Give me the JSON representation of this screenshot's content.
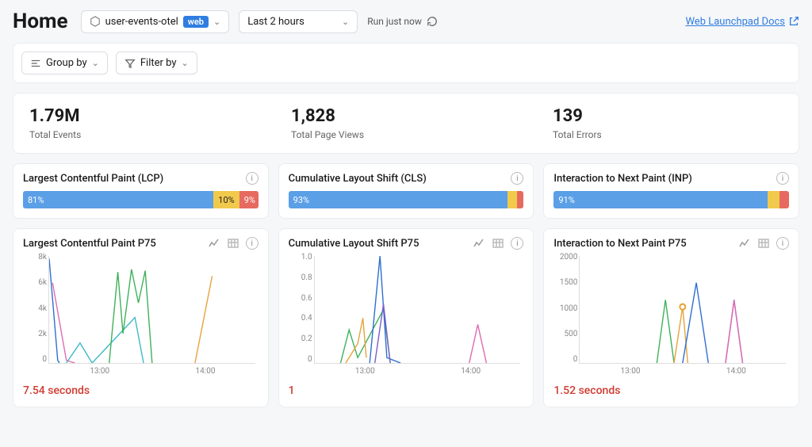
{
  "header": {
    "title": "Home",
    "dataset_name": "user-events-otel",
    "dataset_badge": "web",
    "time_range": "Last 2 hours",
    "run_status": "Run just now",
    "docs_link": "Web Launchpad Docs"
  },
  "filters": {
    "group_by_label": "Group by",
    "filter_by_label": "Filter by"
  },
  "stats": [
    {
      "value": "1.79M",
      "label": "Total Events"
    },
    {
      "value": "1,828",
      "label": "Total Page Views"
    },
    {
      "value": "139",
      "label": "Total Errors"
    }
  ],
  "vitals": [
    {
      "title": "Largest Contentful Paint (LCP)",
      "segments": [
        {
          "color": "blue",
          "pct": 81,
          "label": "81%"
        },
        {
          "color": "yellow",
          "pct": 10,
          "label": "10%"
        },
        {
          "color": "red",
          "pct": 9,
          "label": "9%"
        }
      ]
    },
    {
      "title": "Cumulative Layout Shift (CLS)",
      "segments": [
        {
          "color": "blue",
          "pct": 93,
          "label": "93%"
        },
        {
          "color": "yellow",
          "pct": 3,
          "label": ""
        },
        {
          "color": "red",
          "pct": 4,
          "label": ""
        }
      ]
    },
    {
      "title": "Interaction to Next Paint (INP)",
      "segments": [
        {
          "color": "blue",
          "pct": 91,
          "label": "91%"
        },
        {
          "color": "yellow",
          "pct": 5,
          "label": ""
        },
        {
          "color": "red",
          "pct": 4,
          "label": ""
        }
      ]
    }
  ],
  "p75": [
    {
      "title": "Largest Contentful Paint P75",
      "value": "7.54 seconds",
      "yticks": [
        "8k",
        "6k",
        "4k",
        "2k",
        "0"
      ],
      "xticks": [
        "13:00",
        "14:00"
      ]
    },
    {
      "title": "Cumulative Layout Shift P75",
      "value": "1",
      "yticks": [
        "1.0",
        "0.8",
        "0.6",
        "0.4",
        "0.2",
        "0"
      ],
      "xticks": [
        "13:00",
        "14:00"
      ]
    },
    {
      "title": "Interaction to Next Paint P75",
      "value": "1.52 seconds",
      "yticks": [
        "2000",
        "1500",
        "1000",
        "500",
        "0"
      ],
      "xticks": [
        "13:00",
        "14:00"
      ]
    }
  ],
  "chart_data": [
    {
      "type": "line",
      "title": "Largest Contentful Paint P75",
      "ylabel": "",
      "xlabel": "",
      "ylim": [
        0,
        8000
      ],
      "x_range": [
        "12:30",
        "14:30"
      ],
      "series": [
        {
          "name": "blue",
          "color": "#2f6fd1",
          "points": [
            [
              "12:30",
              7800
            ],
            [
              "12:35",
              200
            ],
            [
              "12:36",
              0
            ]
          ]
        },
        {
          "name": "pink",
          "color": "#e06bb1",
          "points": [
            [
              "12:32",
              6000
            ],
            [
              "12:40",
              200
            ],
            [
              "12:45",
              0
            ]
          ]
        },
        {
          "name": "cyan",
          "color": "#3fb9c9",
          "points": [
            [
              "12:40",
              0
            ],
            [
              "12:48",
              1500
            ],
            [
              "12:55",
              0
            ],
            [
              "13:20",
              3400
            ],
            [
              "13:25",
              0
            ]
          ]
        },
        {
          "name": "green",
          "color": "#3fb15a",
          "points": [
            [
              "13:05",
              0
            ],
            [
              "13:10",
              6800
            ],
            [
              "13:13",
              2200
            ],
            [
              "13:18",
              7000
            ],
            [
              "13:22",
              4500
            ],
            [
              "13:26",
              6900
            ],
            [
              "13:30",
              0
            ]
          ]
        },
        {
          "name": "orange",
          "color": "#e8a33b",
          "points": [
            [
              "13:55",
              0
            ],
            [
              "14:05",
              6500
            ]
          ]
        }
      ]
    },
    {
      "type": "line",
      "title": "Cumulative Layout Shift P75",
      "ylabel": "",
      "xlabel": "",
      "ylim": [
        0,
        1.0
      ],
      "x_range": [
        "12:30",
        "14:30"
      ],
      "series": [
        {
          "name": "green",
          "color": "#3fb15a",
          "points": [
            [
              "12:45",
              0
            ],
            [
              "12:50",
              0.31
            ],
            [
              "12:55",
              0.05
            ],
            [
              "13:10",
              0.5
            ],
            [
              "13:14",
              0
            ]
          ]
        },
        {
          "name": "orange",
          "color": "#e8a33b",
          "points": [
            [
              "12:48",
              0
            ],
            [
              "12:55",
              0.18
            ],
            [
              "12:58",
              0.42
            ],
            [
              "13:00",
              0.05
            ]
          ]
        },
        {
          "name": "blue",
          "color": "#2f6fd1",
          "points": [
            [
              "13:02",
              0
            ],
            [
              "13:08",
              1.0
            ],
            [
              "13:12",
              0.05
            ],
            [
              "13:20",
              0
            ]
          ]
        },
        {
          "name": "purple",
          "color": "#7a5fc9",
          "points": [
            [
              "13:05",
              0
            ],
            [
              "13:10",
              0.55
            ],
            [
              "13:14",
              0
            ]
          ]
        },
        {
          "name": "pink",
          "color": "#e06bb1",
          "points": [
            [
              "14:00",
              0
            ],
            [
              "14:05",
              0.36
            ],
            [
              "14:10",
              0
            ]
          ]
        }
      ]
    },
    {
      "type": "line",
      "title": "Interaction to Next Paint P75",
      "ylabel": "",
      "xlabel": "",
      "ylim": [
        0,
        2000
      ],
      "x_range": [
        "12:30",
        "14:30"
      ],
      "series": [
        {
          "name": "green",
          "color": "#3fb15a",
          "points": [
            [
              "13:15",
              0
            ],
            [
              "13:20",
              1180
            ],
            [
              "13:25",
              0
            ]
          ]
        },
        {
          "name": "orange",
          "color": "#e8a33b",
          "points": [
            [
              "13:25",
              0
            ],
            [
              "13:30",
              1050
            ],
            [
              "13:33",
              0
            ]
          ]
        },
        {
          "name": "blue",
          "color": "#2f6fd1",
          "points": [
            [
              "13:30",
              0
            ],
            [
              "13:38",
              1500
            ],
            [
              "13:45",
              0
            ]
          ]
        },
        {
          "name": "purple",
          "color": "#7a5fc9",
          "points": [
            [
              "13:55",
              0
            ],
            [
              "14:00",
              1180
            ],
            [
              "14:05",
              0
            ]
          ]
        },
        {
          "name": "pink",
          "color": "#e06bb1",
          "points": [
            [
              "13:55",
              0
            ],
            [
              "14:00",
              1170
            ],
            [
              "14:05",
              0
            ]
          ]
        }
      ],
      "marker": {
        "color": "#e8a33b",
        "x": "13:30",
        "y": 1050
      }
    }
  ]
}
